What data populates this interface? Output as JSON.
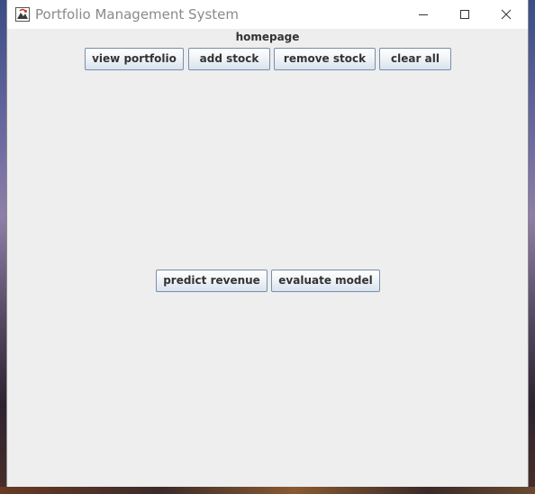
{
  "window": {
    "title": "Portfolio Management System"
  },
  "main": {
    "heading": "homepage",
    "top_buttons": [
      {
        "label": "view portfolio"
      },
      {
        "label": "add stock"
      },
      {
        "label": "remove stock"
      },
      {
        "label": "clear all"
      }
    ],
    "middle_buttons": [
      {
        "label": "predict revenue"
      },
      {
        "label": "evaluate model"
      }
    ]
  },
  "icons": {
    "app": "java-app-icon",
    "minimize": "minimize-icon",
    "maximize": "maximize-icon",
    "close": "close-icon"
  }
}
